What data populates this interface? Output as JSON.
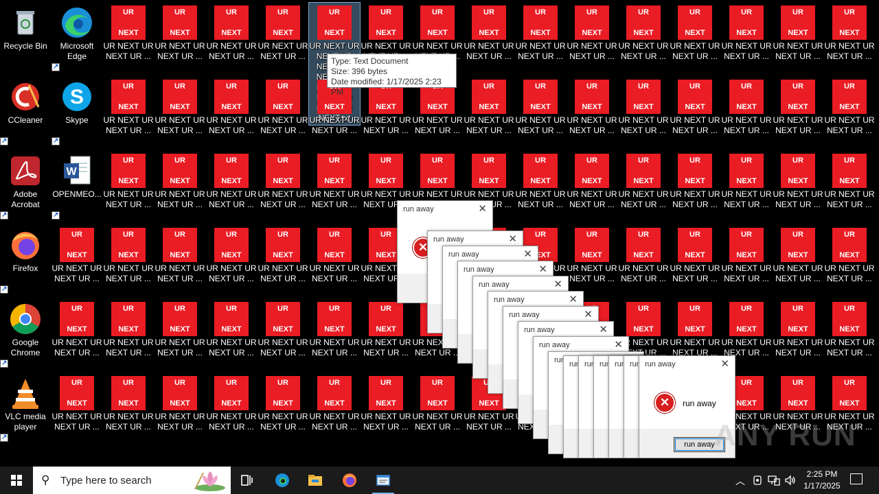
{
  "desktop": {
    "shortcuts": [
      {
        "name": "recycle-bin-icon",
        "label": "Recycle Bin",
        "col": 0,
        "row": 0,
        "kind": "recycle"
      },
      {
        "name": "edge-icon",
        "label": "Microsoft Edge",
        "col": 1,
        "row": 0,
        "kind": "edge"
      },
      {
        "name": "ccleaner-icon",
        "label": "CCleaner",
        "col": 0,
        "row": 1,
        "kind": "ccleaner"
      },
      {
        "name": "skype-icon",
        "label": "Skype",
        "col": 1,
        "row": 1,
        "kind": "skype"
      },
      {
        "name": "acrobat-icon",
        "label": "Adobe Acrobat",
        "col": 0,
        "row": 2,
        "kind": "acrobat"
      },
      {
        "name": "word-document-icon",
        "label": "OPENMEO...",
        "col": 1,
        "row": 2,
        "kind": "word"
      },
      {
        "name": "firefox-icon",
        "label": "Firefox",
        "col": 0,
        "row": 3,
        "kind": "firefox"
      },
      {
        "name": "chrome-icon",
        "label": "Google Chrome",
        "col": 0,
        "row": 4,
        "kind": "chrome"
      },
      {
        "name": "vlc-icon",
        "label": "VLC media player",
        "col": 0,
        "row": 5,
        "kind": "vlc"
      }
    ],
    "spam_file": {
      "tile_top": "UR",
      "tile_bottom": "NEXT",
      "label": "UR NEXT UR NEXT UR ...",
      "selected_label": "UR NEXT UR NEXT UR NEXT UR NEXT UR NEXT UR NEXT UR NEXT UR NEXT.txt",
      "tile_color": "#ea1c24"
    },
    "tooltip": {
      "type": "Type: Text Document",
      "size": "Size: 396 bytes",
      "modified": "Date modified: 1/17/2025 2:23 PM"
    }
  },
  "dialogs": {
    "title": "run away",
    "message": "run away",
    "button_label": "run away",
    "close_glyph": "✕",
    "error_glyph": "✕"
  },
  "watermark": "ANY RUN",
  "taskbar": {
    "search_placeholder": "Type here to search",
    "apps": [
      "task-view-icon",
      "edge-taskbar-icon",
      "file-explorer-icon",
      "firefox-taskbar-icon",
      "notepad-taskbar-icon"
    ],
    "time": "2:25 PM",
    "date": "1/17/2025",
    "accent": "#78b4e6"
  }
}
